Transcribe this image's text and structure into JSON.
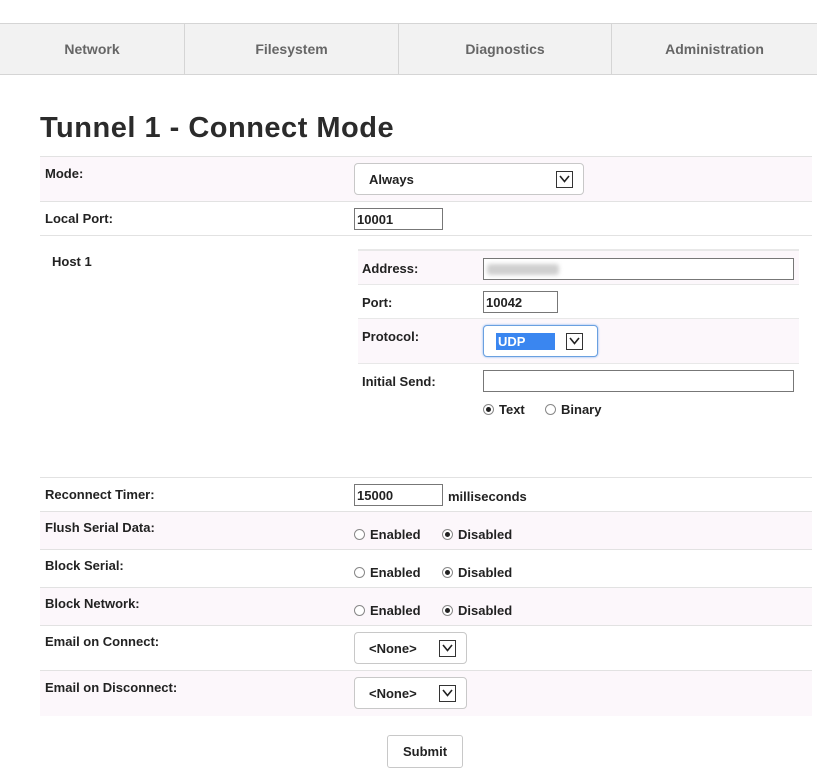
{
  "nav": {
    "items": [
      {
        "label": "Network"
      },
      {
        "label": "Filesystem"
      },
      {
        "label": "Diagnostics"
      },
      {
        "label": "Administration"
      }
    ]
  },
  "page": {
    "title": "Tunnel 1 - Connect Mode"
  },
  "form": {
    "mode": {
      "label": "Mode:",
      "value": "Always"
    },
    "local_port": {
      "label": "Local Port:",
      "value": "10001"
    },
    "host": {
      "title": "Host 1",
      "address": {
        "label": "Address:",
        "value": ""
      },
      "port": {
        "label": "Port:",
        "value": "10042"
      },
      "protocol": {
        "label": "Protocol:",
        "value": "UDP"
      },
      "initial_send": {
        "label": "Initial Send:",
        "value": "",
        "options": [
          "Text",
          "Binary"
        ],
        "selected": "Text"
      }
    },
    "reconnect_timer": {
      "label": "Reconnect Timer:",
      "value": "15000",
      "unit": "milliseconds"
    },
    "flush_serial": {
      "label": "Flush Serial Data:",
      "options": [
        "Enabled",
        "Disabled"
      ],
      "selected": "Disabled"
    },
    "block_serial": {
      "label": "Block Serial:",
      "options": [
        "Enabled",
        "Disabled"
      ],
      "selected": "Disabled"
    },
    "block_network": {
      "label": "Block Network:",
      "options": [
        "Enabled",
        "Disabled"
      ],
      "selected": "Disabled"
    },
    "email_connect": {
      "label": "Email on Connect:",
      "value": "<None>"
    },
    "email_disconnect": {
      "label": "Email on Disconnect:",
      "value": "<None>"
    },
    "submit_label": "Submit"
  }
}
